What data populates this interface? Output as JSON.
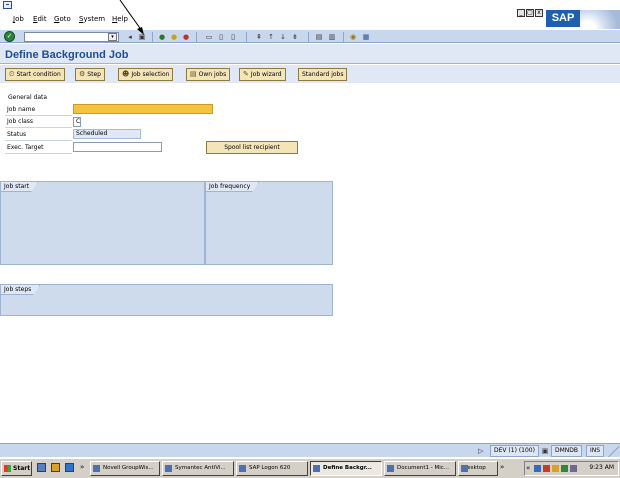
{
  "menu": {
    "items": [
      "Job",
      "Edit",
      "Goto",
      "System",
      "Help"
    ]
  },
  "logo": "SAP",
  "window_controls": [
    "_",
    "▢",
    "x"
  ],
  "std_toolbar": {
    "command_value": ""
  },
  "page_title": "Define Background Job",
  "app_toolbar": {
    "buttons": [
      "Start condition",
      "Step",
      "Job selection",
      "Own jobs",
      "Job wizard",
      "Standard jobs"
    ]
  },
  "form": {
    "section_label": "General data",
    "job_name_label": "Job name",
    "job_name_value": "",
    "job_class_label": "Job class",
    "job_class_value": "C",
    "status_label": "Status",
    "status_value": "Scheduled",
    "exec_target_label": "Exec. Target",
    "exec_target_value": "",
    "spool_button": "Spool list recipient"
  },
  "groups": {
    "job_start": "Job start",
    "job_frequency": "Job frequency",
    "job_steps": "Job steps"
  },
  "status_bar": {
    "system": "DEV (1) (100)",
    "server": "DMNDB",
    "mode": "INS"
  },
  "taskbar": {
    "start": "Start",
    "quick_launch_more": "»",
    "tasks": [
      "Novell GroupWis...",
      "Symantec AntiVi...",
      "SAP Logon 620",
      "Define Backgr...",
      "Document1 - Mic...",
      "Desktop"
    ],
    "active_task": "Define Backgr...",
    "tray_more": "«",
    "clock": "9:23 AM"
  },
  "colors": {
    "title": "#1f4e96",
    "toolbar_bg": "#c8d7ec",
    "button_bg": "#f3e5b8",
    "required_field": "#f5c242",
    "group_bg": "#cddbec"
  }
}
